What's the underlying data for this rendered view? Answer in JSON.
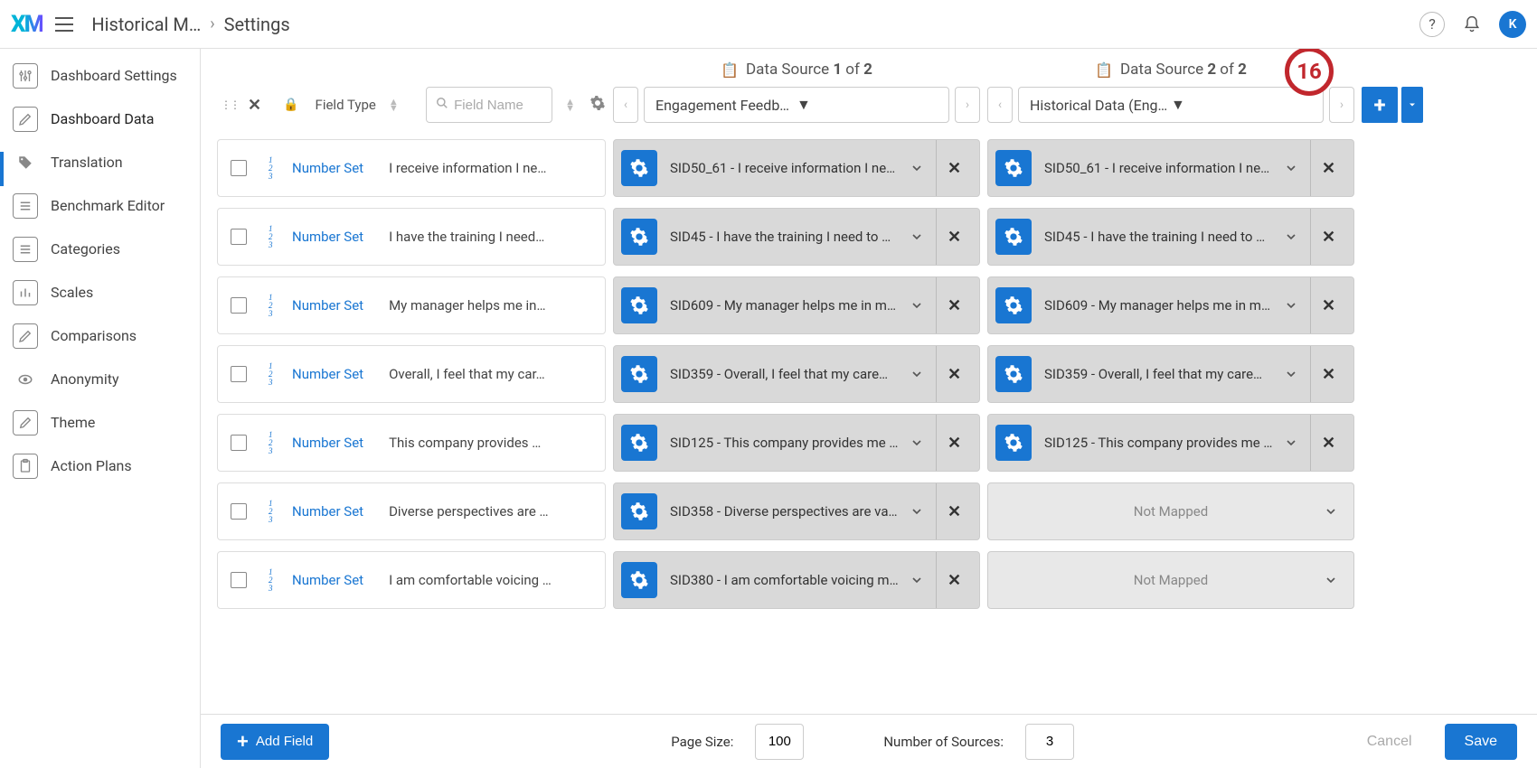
{
  "header": {
    "logo_x": "X",
    "logo_m": "M",
    "breadcrumb_1": "Historical M…",
    "breadcrumb_2": "Settings",
    "avatar_initial": "K"
  },
  "sidebar": {
    "items": [
      {
        "label": "Dashboard Settings"
      },
      {
        "label": "Dashboard Data"
      },
      {
        "label": "Translation"
      },
      {
        "label": "Benchmark Editor"
      },
      {
        "label": "Categories"
      },
      {
        "label": "Scales"
      },
      {
        "label": "Comparisons"
      },
      {
        "label": "Anonymity"
      },
      {
        "label": "Theme"
      },
      {
        "label": "Action Plans"
      }
    ]
  },
  "fields_header": {
    "field_type": "Field Type",
    "search_placeholder": "Field Name"
  },
  "sources": [
    {
      "header_prefix": "Data Source ",
      "index": "1",
      "of_label": " of ",
      "total": "2",
      "selected": "Engagement Feedback Template"
    },
    {
      "header_prefix": "Data Source ",
      "index": "2",
      "of_label": " of ",
      "total": "2",
      "selected": "Historical Data (Engagement Fe…"
    }
  ],
  "rows": [
    {
      "type": "Number Set",
      "name": "I receive information I ne…",
      "s1": "SID50_61 - I receive information I ne…",
      "s2": "SID50_61 - I receive information I ne…",
      "s2_mapped": true
    },
    {
      "type": "Number Set",
      "name": "I have the training I need…",
      "s1": "SID45 - I have the training I need to …",
      "s2": "SID45 - I have the training I need to …",
      "s2_mapped": true
    },
    {
      "type": "Number Set",
      "name": "My manager helps me in…",
      "s1": "SID609 - My manager helps me in m…",
      "s2": "SID609 - My manager helps me in m…",
      "s2_mapped": true
    },
    {
      "type": "Number Set",
      "name": "Overall, I feel that my car…",
      "s1": "SID359 - Overall, I feel that my care…",
      "s2": "SID359 - Overall, I feel that my care…",
      "s2_mapped": true
    },
    {
      "type": "Number Set",
      "name": "This company provides …",
      "s1": "SID125 - This company provides me …",
      "s2": "SID125 - This company provides me …",
      "s2_mapped": true
    },
    {
      "type": "Number Set",
      "name": "Diverse perspectives are …",
      "s1": "SID358 - Diverse perspectives are va…",
      "s2": "Not Mapped",
      "s2_mapped": false
    },
    {
      "type": "Number Set",
      "name": "I am comfortable voicing …",
      "s1": "SID380 - I am comfortable voicing m…",
      "s2": "Not Mapped",
      "s2_mapped": false
    }
  ],
  "footer": {
    "add_field": "Add Field",
    "page_size_label": "Page Size:",
    "page_size_value": "100",
    "num_sources_label": "Number of Sources:",
    "num_sources_value": "3",
    "cancel": "Cancel",
    "save": "Save"
  },
  "annotation": "16",
  "not_mapped_text": "Not Mapped"
}
